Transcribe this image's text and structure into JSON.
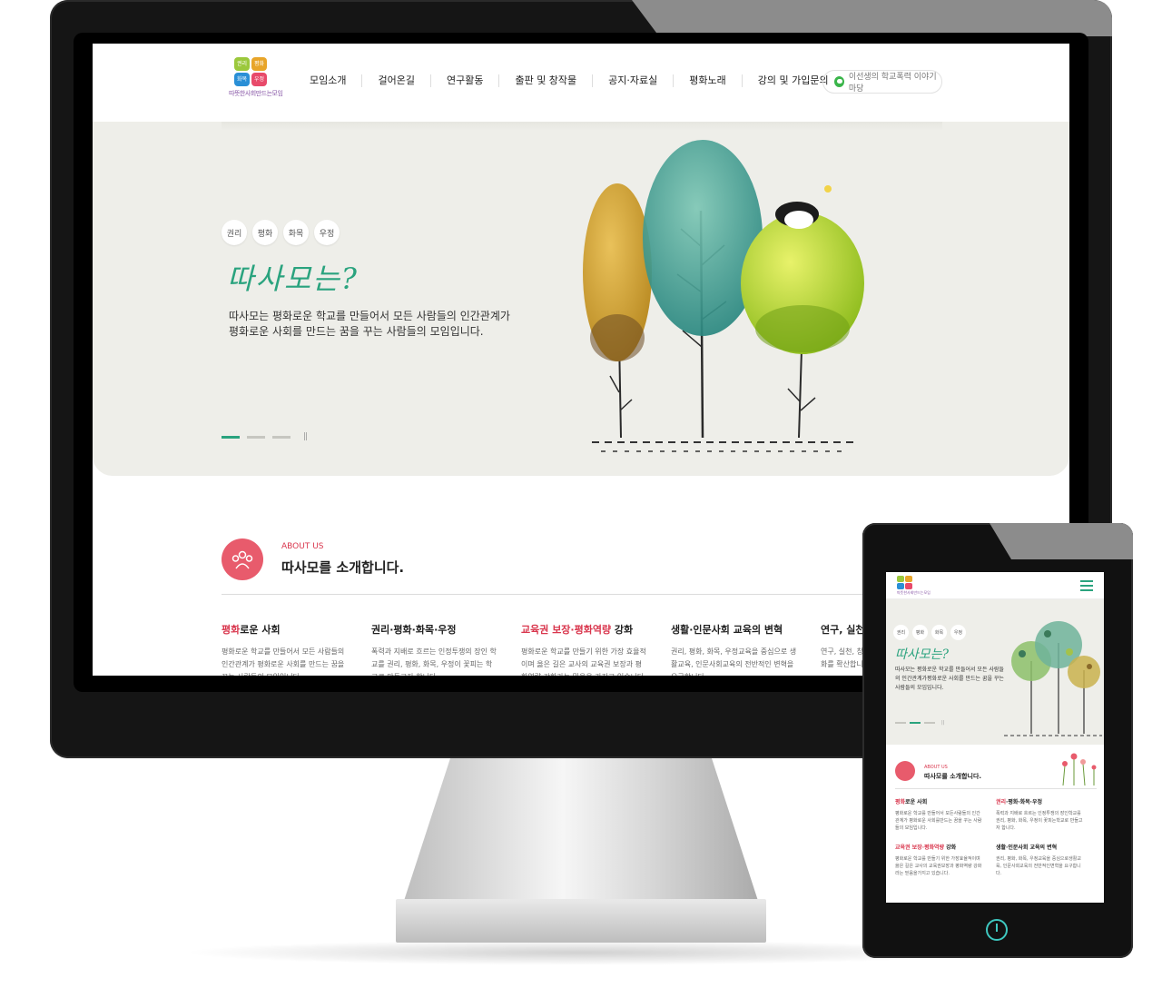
{
  "colors": {
    "accent_green": "#2aa37e",
    "accent_red": "#d9364d",
    "hero_bg": "#eeeee9",
    "icon_pink": "#e85b6c"
  },
  "logo": {
    "tiles": [
      "권리",
      "평화",
      "화목",
      "우정"
    ],
    "tile_colors": [
      "#9bc83c",
      "#e8a52a",
      "#2a8fd6",
      "#e84a6a"
    ],
    "subtitle": "따뜻한사회만드는모임"
  },
  "nav": {
    "items": [
      "모임소개",
      "걸어온길",
      "연구활동",
      "출판 및 창작물",
      "공지·자료실",
      "평화노래",
      "강의 및 가입문의"
    ],
    "talk_button": "이선생의 학교폭력 이야기마당"
  },
  "hero": {
    "pills": [
      "권리",
      "평화",
      "화목",
      "우정"
    ],
    "title": "따사모는?",
    "description": "따사모는 평화로운 학교를 만들어서 모든 사람들의 인간관계가 평화로운 사회를 만드는 꿈을 꾸는 사람들의 모임입니다.",
    "slider": {
      "total": 3,
      "active": 1,
      "pause_label": "||"
    }
  },
  "about": {
    "kicker": "ABOUT US",
    "title": "따사모를 소개합니다.",
    "columns": [
      {
        "title_red": "평화",
        "title_rest": "로운 사회",
        "text": "평화로운 학교를 만들어서 모든 사람들의 인간관계가 평화로운 사회를 만드는 꿈을 꾸는 사람들의 모임입니다."
      },
      {
        "title_red": "",
        "title_rest": "권리·평화·화목·우정",
        "text": "폭력과 지배로 흐르는 인정투쟁의 장인 학교를 권리, 평화, 화목, 우정이 꽃피는 학교로 만들고자 합니다."
      },
      {
        "title_red": "교육권 보장·평화역량",
        "title_rest": " 강화",
        "text": "평화로운 학교를 만들기 위한 가장 효율적이며 옳은 길은 교사의 교육권 보장과 평화역량 강화라는 믿음을 가지고 있습니다."
      },
      {
        "title_red": "",
        "title_rest": "생활·인문사회 교육의 변혁",
        "text": "권리, 평화, 화목, 우정교육을 중심으로 생활교육, 인문사회교육의 전반적인 변혁을 요구합니다."
      },
      {
        "title_red": "",
        "title_rest": "연구, 실천, 창작",
        "text": "연구, 실천, 창작을 통해 평화로운 학교문화를 확산합니다."
      }
    ]
  },
  "mobile": {
    "hero_description": "따사모는 평화로운 학교를 만들어서 모든 사람들의 인간관계가평화로운 사회를 만드는 꿈을 꾸는 사람들의 모임입니다.",
    "cells": [
      {
        "title_red": "평화",
        "title_rest": "로운 사회",
        "text": "평화로운 학교를 만들어서 모든사람들의 인간관계가 평화로운 사회를만드는 꿈을 꾸는 사람들의 모임입니다."
      },
      {
        "title_red": "권리",
        "title_rest": "·평화·화목·우정",
        "text": "폭력과 지배로 흐르는 인정투쟁의 장인학교를 권리, 평화, 화목, 우정이 꽃피는학교로 만들고자 합니다."
      },
      {
        "title_red": "교육권 보장·평화역량",
        "title_rest": " 강화",
        "text": "평화로운 학교를 만들기 위한 가장효율적이며 옳은 길은 교사의 교육권보장과 평화역량 강화라는 믿음을가지고 있습니다."
      },
      {
        "title_red": "",
        "title_rest": "생활·인문사회 교육의 변혁",
        "text": "권리, 평화, 화목, 우정교육을 중심으로생활교육, 인문사회교육의 전반적인변혁을 요구합니다."
      }
    ]
  }
}
